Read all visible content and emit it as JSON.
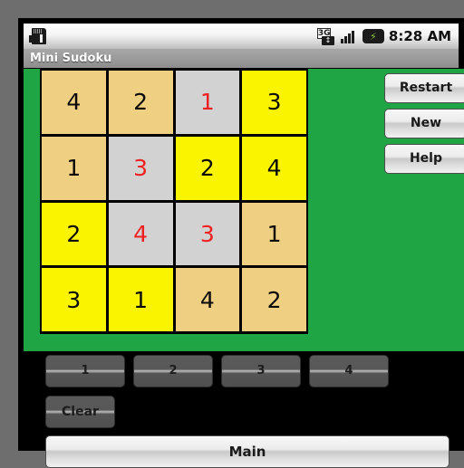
{
  "status_bar": {
    "sdcard_icon": "sdcard-icon",
    "network_icon": "3g-network-icon",
    "network_label": "3G",
    "network_arrows": "↕",
    "signal_icon": "signal-bars-icon",
    "battery_icon": "battery-charging-icon",
    "battery_glyph": "⚡",
    "clock": "8:28 AM"
  },
  "title_bar": {
    "title": "Mini Sudoku"
  },
  "colors": {
    "given_cell": "#efcf82",
    "selected_cell": "#d2d2d2",
    "highlight_cell": "#fbf400",
    "panel_green": "#1fa544",
    "user_number": "#ef2020",
    "given_number": "#0a0a0a"
  },
  "grid": {
    "rows": 4,
    "cols": 4,
    "cells": [
      {
        "value": "4",
        "bg": "tan",
        "color": "black"
      },
      {
        "value": "2",
        "bg": "tan",
        "color": "black"
      },
      {
        "value": "1",
        "bg": "gray",
        "color": "red"
      },
      {
        "value": "3",
        "bg": "yellow",
        "color": "black"
      },
      {
        "value": "1",
        "bg": "tan",
        "color": "black"
      },
      {
        "value": "3",
        "bg": "gray",
        "color": "red"
      },
      {
        "value": "2",
        "bg": "yellow",
        "color": "black"
      },
      {
        "value": "4",
        "bg": "yellow",
        "color": "black"
      },
      {
        "value": "2",
        "bg": "yellow",
        "color": "black"
      },
      {
        "value": "4",
        "bg": "gray",
        "color": "red"
      },
      {
        "value": "3",
        "bg": "gray",
        "color": "red"
      },
      {
        "value": "1",
        "bg": "tan",
        "color": "black"
      },
      {
        "value": "3",
        "bg": "yellow",
        "color": "black"
      },
      {
        "value": "1",
        "bg": "yellow",
        "color": "black"
      },
      {
        "value": "4",
        "bg": "tan",
        "color": "black"
      },
      {
        "value": "2",
        "bg": "tan",
        "color": "black"
      }
    ]
  },
  "side_buttons": {
    "restart": "Restart",
    "new": "New",
    "help": "Help"
  },
  "number_buttons": [
    {
      "label": "1"
    },
    {
      "label": "2"
    },
    {
      "label": "3"
    },
    {
      "label": "4"
    }
  ],
  "clear_button": {
    "label": "Clear"
  },
  "main_button": {
    "label": "Main"
  }
}
